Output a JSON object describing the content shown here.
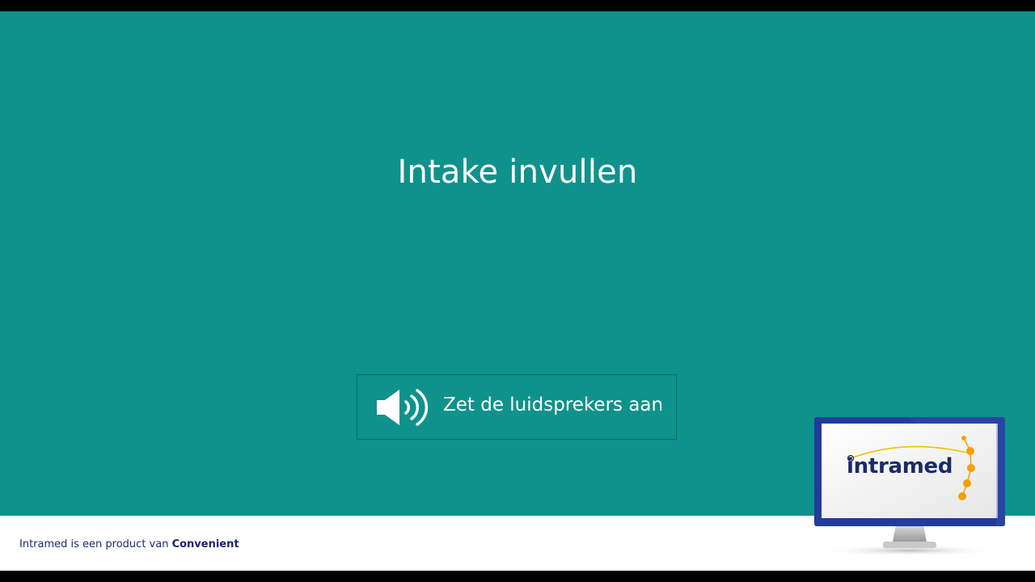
{
  "slide": {
    "title": "Intake invullen",
    "speaker_notice": "Zet de luidsprekers aan",
    "background_color": "#0f928c"
  },
  "footer": {
    "text": "Intramed is een product van ",
    "brand": "Convenient"
  },
  "logo": {
    "text": "intramed"
  },
  "icons": {
    "speaker": "speaker-volume-icon",
    "monitor": "monitor-icon"
  }
}
